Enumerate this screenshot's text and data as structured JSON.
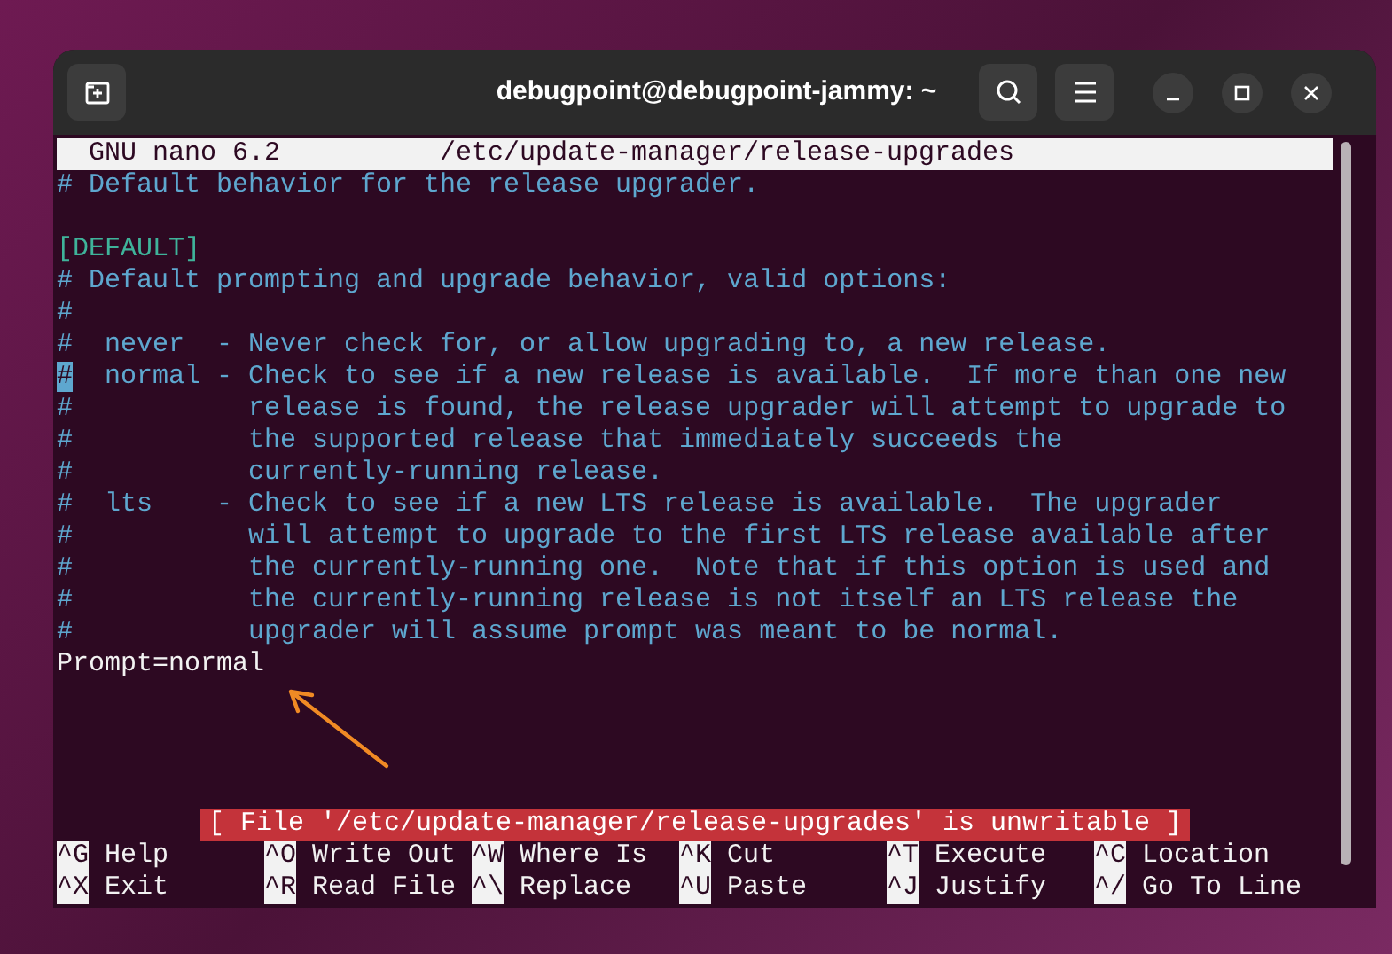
{
  "window": {
    "title": "debugpoint@debugpoint-jammy: ~"
  },
  "nano": {
    "version": "GNU nano 6.2",
    "filename": "/etc/update-manager/release-upgrades"
  },
  "lines": [
    {
      "kind": "comment",
      "text": "# Default behavior for the release upgrader.",
      "cursor": false
    },
    {
      "kind": "blank",
      "cursor": false
    },
    {
      "kind": "section",
      "text": "[DEFAULT]",
      "cursor": false
    },
    {
      "kind": "comment",
      "text": "# Default prompting and upgrade behavior, valid options:",
      "cursor": false
    },
    {
      "kind": "comment",
      "text": "#",
      "cursor": false
    },
    {
      "kind": "comment",
      "text": "#  never  - Never check for, or allow upgrading to, a new release.",
      "cursor": false
    },
    {
      "kind": "comment",
      "text": "#  normal - Check to see if a new release is available.  If more than one new",
      "cursor": true
    },
    {
      "kind": "comment",
      "text": "#           release is found, the release upgrader will attempt to upgrade to",
      "cursor": false
    },
    {
      "kind": "comment",
      "text": "#           the supported release that immediately succeeds the",
      "cursor": false
    },
    {
      "kind": "comment",
      "text": "#           currently-running release.",
      "cursor": false
    },
    {
      "kind": "comment",
      "text": "#  lts    - Check to see if a new LTS release is available.  The upgrader",
      "cursor": false
    },
    {
      "kind": "comment",
      "text": "#           will attempt to upgrade to the first LTS release available after",
      "cursor": false
    },
    {
      "kind": "comment",
      "text": "#           the currently-running one.  Note that if this option is used and",
      "cursor": false
    },
    {
      "kind": "comment",
      "text": "#           the currently-running release is not itself an LTS release the",
      "cursor": false
    },
    {
      "kind": "comment",
      "text": "#           upgrader will assume prompt was meant to be normal.",
      "cursor": false
    },
    {
      "kind": "setting",
      "text": "Prompt=normal",
      "cursor": false
    }
  ],
  "status_message": "[ File '/etc/update-manager/release-upgrades' is unwritable ]",
  "shortcuts": [
    [
      {
        "key": "^G",
        "label": "Help"
      },
      {
        "key": "^O",
        "label": "Write Out"
      },
      {
        "key": "^W",
        "label": "Where Is"
      },
      {
        "key": "^K",
        "label": "Cut"
      },
      {
        "key": "^T",
        "label": "Execute"
      },
      {
        "key": "^C",
        "label": "Location"
      }
    ],
    [
      {
        "key": "^X",
        "label": "Exit"
      },
      {
        "key": "^R",
        "label": "Read File"
      },
      {
        "key": "^\\",
        "label": "Replace"
      },
      {
        "key": "^U",
        "label": "Paste"
      },
      {
        "key": "^J",
        "label": "Justify"
      },
      {
        "key": "^/",
        "label": "Go To Line"
      }
    ]
  ]
}
